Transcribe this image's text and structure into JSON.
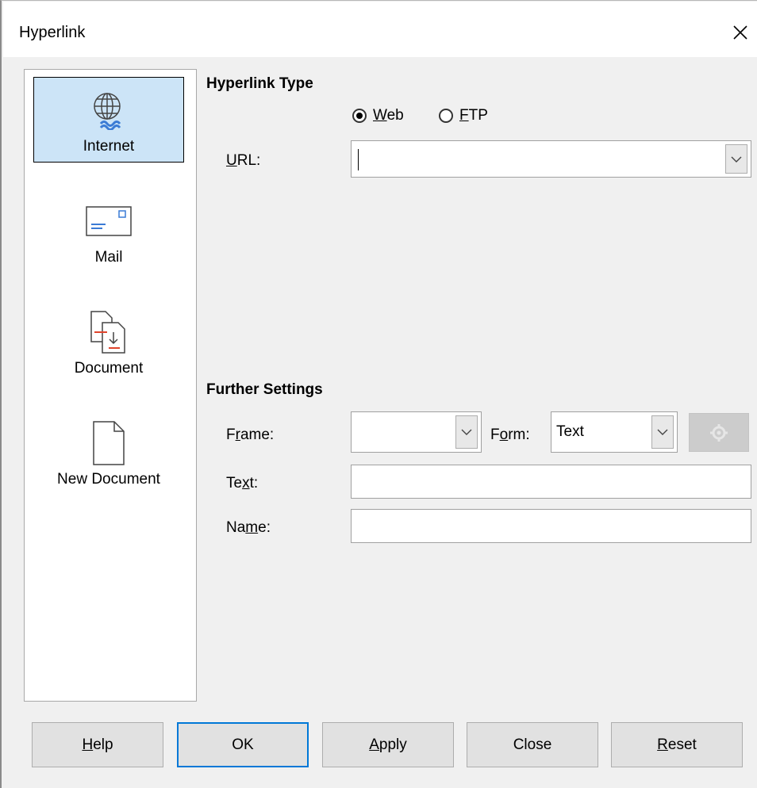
{
  "window": {
    "title": "Hyperlink"
  },
  "sidebar": {
    "items": [
      {
        "label": "Internet",
        "selected": true
      },
      {
        "label": "Mail",
        "selected": false
      },
      {
        "label": "Document",
        "selected": false
      },
      {
        "label": "New Document",
        "selected": false
      }
    ]
  },
  "hyperlink_type": {
    "title": "Hyperlink Type",
    "radios": [
      {
        "prefix": "",
        "mnemonic": "W",
        "rest": "eb",
        "checked": true
      },
      {
        "prefix": "",
        "mnemonic": "F",
        "rest": "TP",
        "checked": false
      }
    ],
    "url_label": {
      "prefix": "",
      "mnemonic": "U",
      "rest": "RL:"
    },
    "url_value": ""
  },
  "further_settings": {
    "title": "Further Settings",
    "frame_label": {
      "prefix": "F",
      "mnemonic": "r",
      "rest": "ame:"
    },
    "frame_value": "",
    "form_label": {
      "prefix": "F",
      "mnemonic": "o",
      "rest": "rm:"
    },
    "form_value": "Text",
    "text_label": {
      "prefix": "Te",
      "mnemonic": "x",
      "rest": "t:"
    },
    "text_value": "",
    "name_label": {
      "prefix": "Na",
      "mnemonic": "m",
      "rest": "e:"
    },
    "name_value": ""
  },
  "buttons": {
    "help": {
      "prefix": "",
      "mnemonic": "H",
      "rest": "elp"
    },
    "ok": "OK",
    "apply": {
      "prefix": "",
      "mnemonic": "A",
      "rest": "pply"
    },
    "close": "Close",
    "reset": {
      "prefix": "",
      "mnemonic": "R",
      "rest": "eset"
    }
  },
  "colors": {
    "selection_bg": "#cce4f7",
    "default_button_border": "#0078d7",
    "icon_blue": "#3a7bd5",
    "icon_red": "#e0442c"
  }
}
